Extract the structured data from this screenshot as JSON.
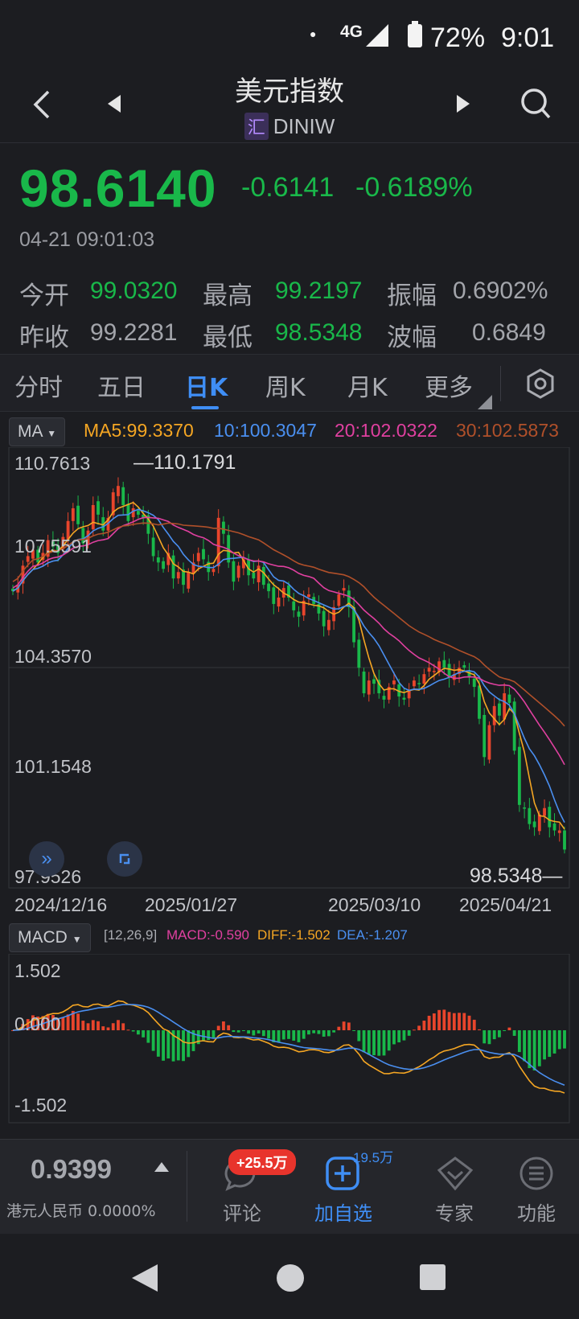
{
  "status_bar": {
    "network": "4G",
    "battery": "72%",
    "time": "9:01"
  },
  "header": {
    "title": "美元指数",
    "badge": "汇",
    "code": "DINIW"
  },
  "quote": {
    "price": "98.6140",
    "change": "-0.6141",
    "change_pct": "-0.6189%",
    "timestamp": "04-21 09:01:03"
  },
  "stats": {
    "open_label": "今开",
    "open": "99.0320",
    "high_label": "最高",
    "high": "99.2197",
    "amp_label": "振幅",
    "amp": "0.6902%",
    "prev_label": "昨收",
    "prev": "99.2281",
    "low_label": "最低",
    "low": "98.5348",
    "wave_label": "波幅",
    "wave": "0.6849"
  },
  "tabs": [
    "分时",
    "五日",
    "日K",
    "周K",
    "月K",
    "更多"
  ],
  "active_tab": "日K",
  "ma_bar": {
    "selector": "MA",
    "ma5": "MA5:99.3370",
    "ma10": "10:100.3047",
    "ma20": "20:102.0322",
    "ma30": "30:102.5873"
  },
  "colors": {
    "up": "#e8452c",
    "down": "#19b84a",
    "ma5": "#f5a623",
    "ma10": "#4a8ff0",
    "ma20": "#e040a0",
    "ma30": "#b0502a",
    "accent": "#3f8ef5"
  },
  "main_chart": {
    "y_ticks": [
      "110.7613",
      "107.5591",
      "104.3570",
      "101.1548",
      "97.9526"
    ],
    "max_label": "110.1791",
    "min_label": "98.5348",
    "dates": [
      "2024/12/16",
      "2025/01/27",
      "2025/03/10",
      "2025/04/21"
    ]
  },
  "macd_bar": {
    "selector": "MACD",
    "params": "[12,26,9]",
    "macd": "MACD:-0.590",
    "diff": "DIFF:-1.502",
    "dea": "DEA:-1.207"
  },
  "macd_chart": {
    "y_ticks": [
      "1.502",
      "0.000",
      "-1.502"
    ]
  },
  "bottom": {
    "hkd_value": "0.9399",
    "hkd_label": "港元人民币 0.0000%",
    "comment_badge": "+25.5万",
    "comment_label": "评论",
    "watch_count": "19.5万",
    "watch_label": "加自选",
    "expert_label": "专家",
    "func_label": "功能"
  },
  "chart_data": {
    "type": "candlestick",
    "closes": [
      106.7,
      106.9,
      107.5,
      107.8,
      108.0,
      107.6,
      107.9,
      108.3,
      108.1,
      107.9,
      108.4,
      108.9,
      109.3,
      108.8,
      108.2,
      108.6,
      109.4,
      109.1,
      108.6,
      109.0,
      109.8,
      110.0,
      109.4,
      108.9,
      109.3,
      109.1,
      109.0,
      108.5,
      107.8,
      107.6,
      107.4,
      107.9,
      107.1,
      107.3,
      106.9,
      107.3,
      107.6,
      107.9,
      107.7,
      107.3,
      107.4,
      109.0,
      108.5,
      107.6,
      107.0,
      107.5,
      107.7,
      107.2,
      107.1,
      107.5,
      106.9,
      106.7,
      106.3,
      106.5,
      106.8,
      106.5,
      106.1,
      105.9,
      106.4,
      106.6,
      106.3,
      106.0,
      105.6,
      105.8,
      106.2,
      106.6,
      106.8,
      106.2,
      105.1,
      104.3,
      103.5,
      103.9,
      103.8,
      103.5,
      103.3,
      103.7,
      103.9,
      103.4,
      103.3,
      103.6,
      103.9,
      103.8,
      104.1,
      104.3,
      104.2,
      104.5,
      104.3,
      104.0,
      104.1,
      104.3,
      104.3,
      104.0,
      103.7,
      102.7,
      101.5,
      102.5,
      103.1,
      102.8,
      103.5,
      103.2,
      101.7,
      100.0,
      99.9,
      99.4,
      99.3,
      99.7,
      99.9,
      99.3,
      99.2,
      99.2,
      98.6
    ],
    "ma5_last": 99.337,
    "ma10_last": 100.3047,
    "ma20_last": 102.0322,
    "ma30_last": 102.5873,
    "ylim": [
      97.9526,
      110.7613
    ],
    "macd_ylim": [
      -1.502,
      1.502
    ]
  }
}
